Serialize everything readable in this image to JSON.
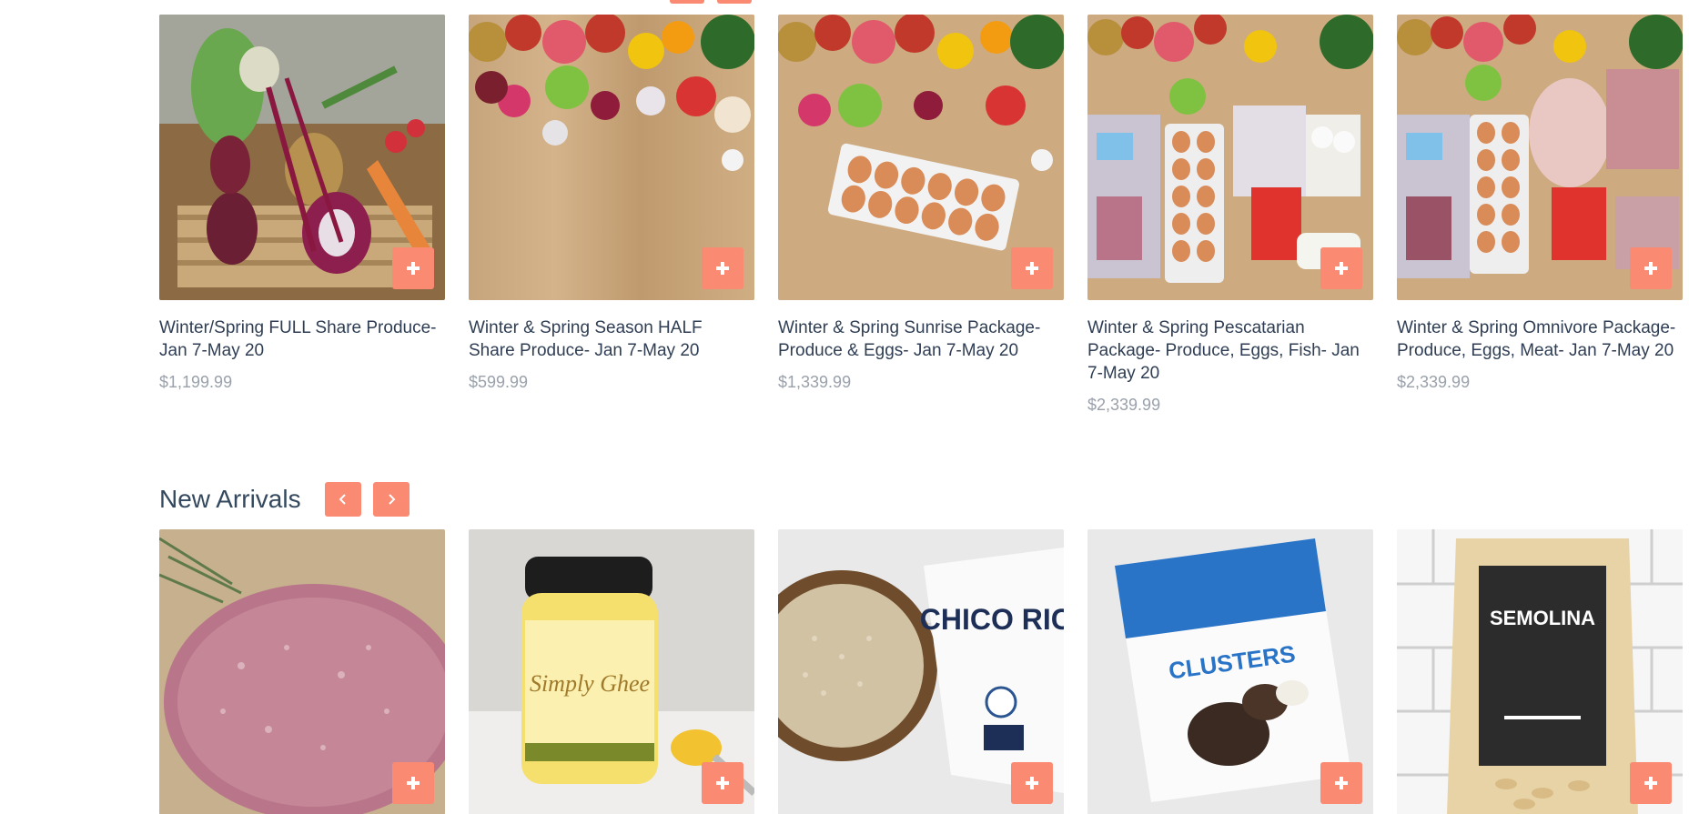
{
  "colors": {
    "accent": "#fa8a72",
    "title": "#2f3e54",
    "price": "#9aa1ab"
  },
  "featured_products": [
    {
      "title": "Winter/Spring FULL Share Produce- Jan 7-May 20",
      "price": "$1,199.99",
      "image": "vegetable-crate-photo"
    },
    {
      "title": "Winter & Spring Season HALF Share Produce- Jan 7-May 20",
      "price": "$599.99",
      "image": "fruit-vegetables-on-wood-photo"
    },
    {
      "title": "Winter & Spring Sunrise Package- Produce & Eggs- Jan 7-May 20",
      "price": "$1,339.99",
      "image": "produce-and-eggs-photo"
    },
    {
      "title": "Winter & Spring Pescatarian Package- Produce, Eggs, Fish- Jan 7-May 20",
      "price": "$2,339.99",
      "image": "produce-eggs-fish-photo"
    },
    {
      "title": "Winter & Spring Omnivore Package- Produce, Eggs, Meat- Jan 7-May 20",
      "price": "$2,339.99",
      "image": "produce-eggs-meat-photo"
    }
  ],
  "new_arrivals": {
    "heading": "New Arrivals",
    "prev_icon": "chevron-left-icon",
    "next_icon": "chevron-right-icon",
    "items": [
      {
        "image": "ground-meat-patty-photo"
      },
      {
        "image": "simply-ghee-jar-photo",
        "label_text": "Simply Ghee"
      },
      {
        "image": "chico-rice-bag-photo",
        "label_text": "CHICO RICE"
      },
      {
        "image": "clusters-snack-bag-photo",
        "label_text": "CLUSTERS"
      },
      {
        "image": "semolina-pasta-bag-photo",
        "label_text": "SEMOLINA"
      }
    ]
  }
}
